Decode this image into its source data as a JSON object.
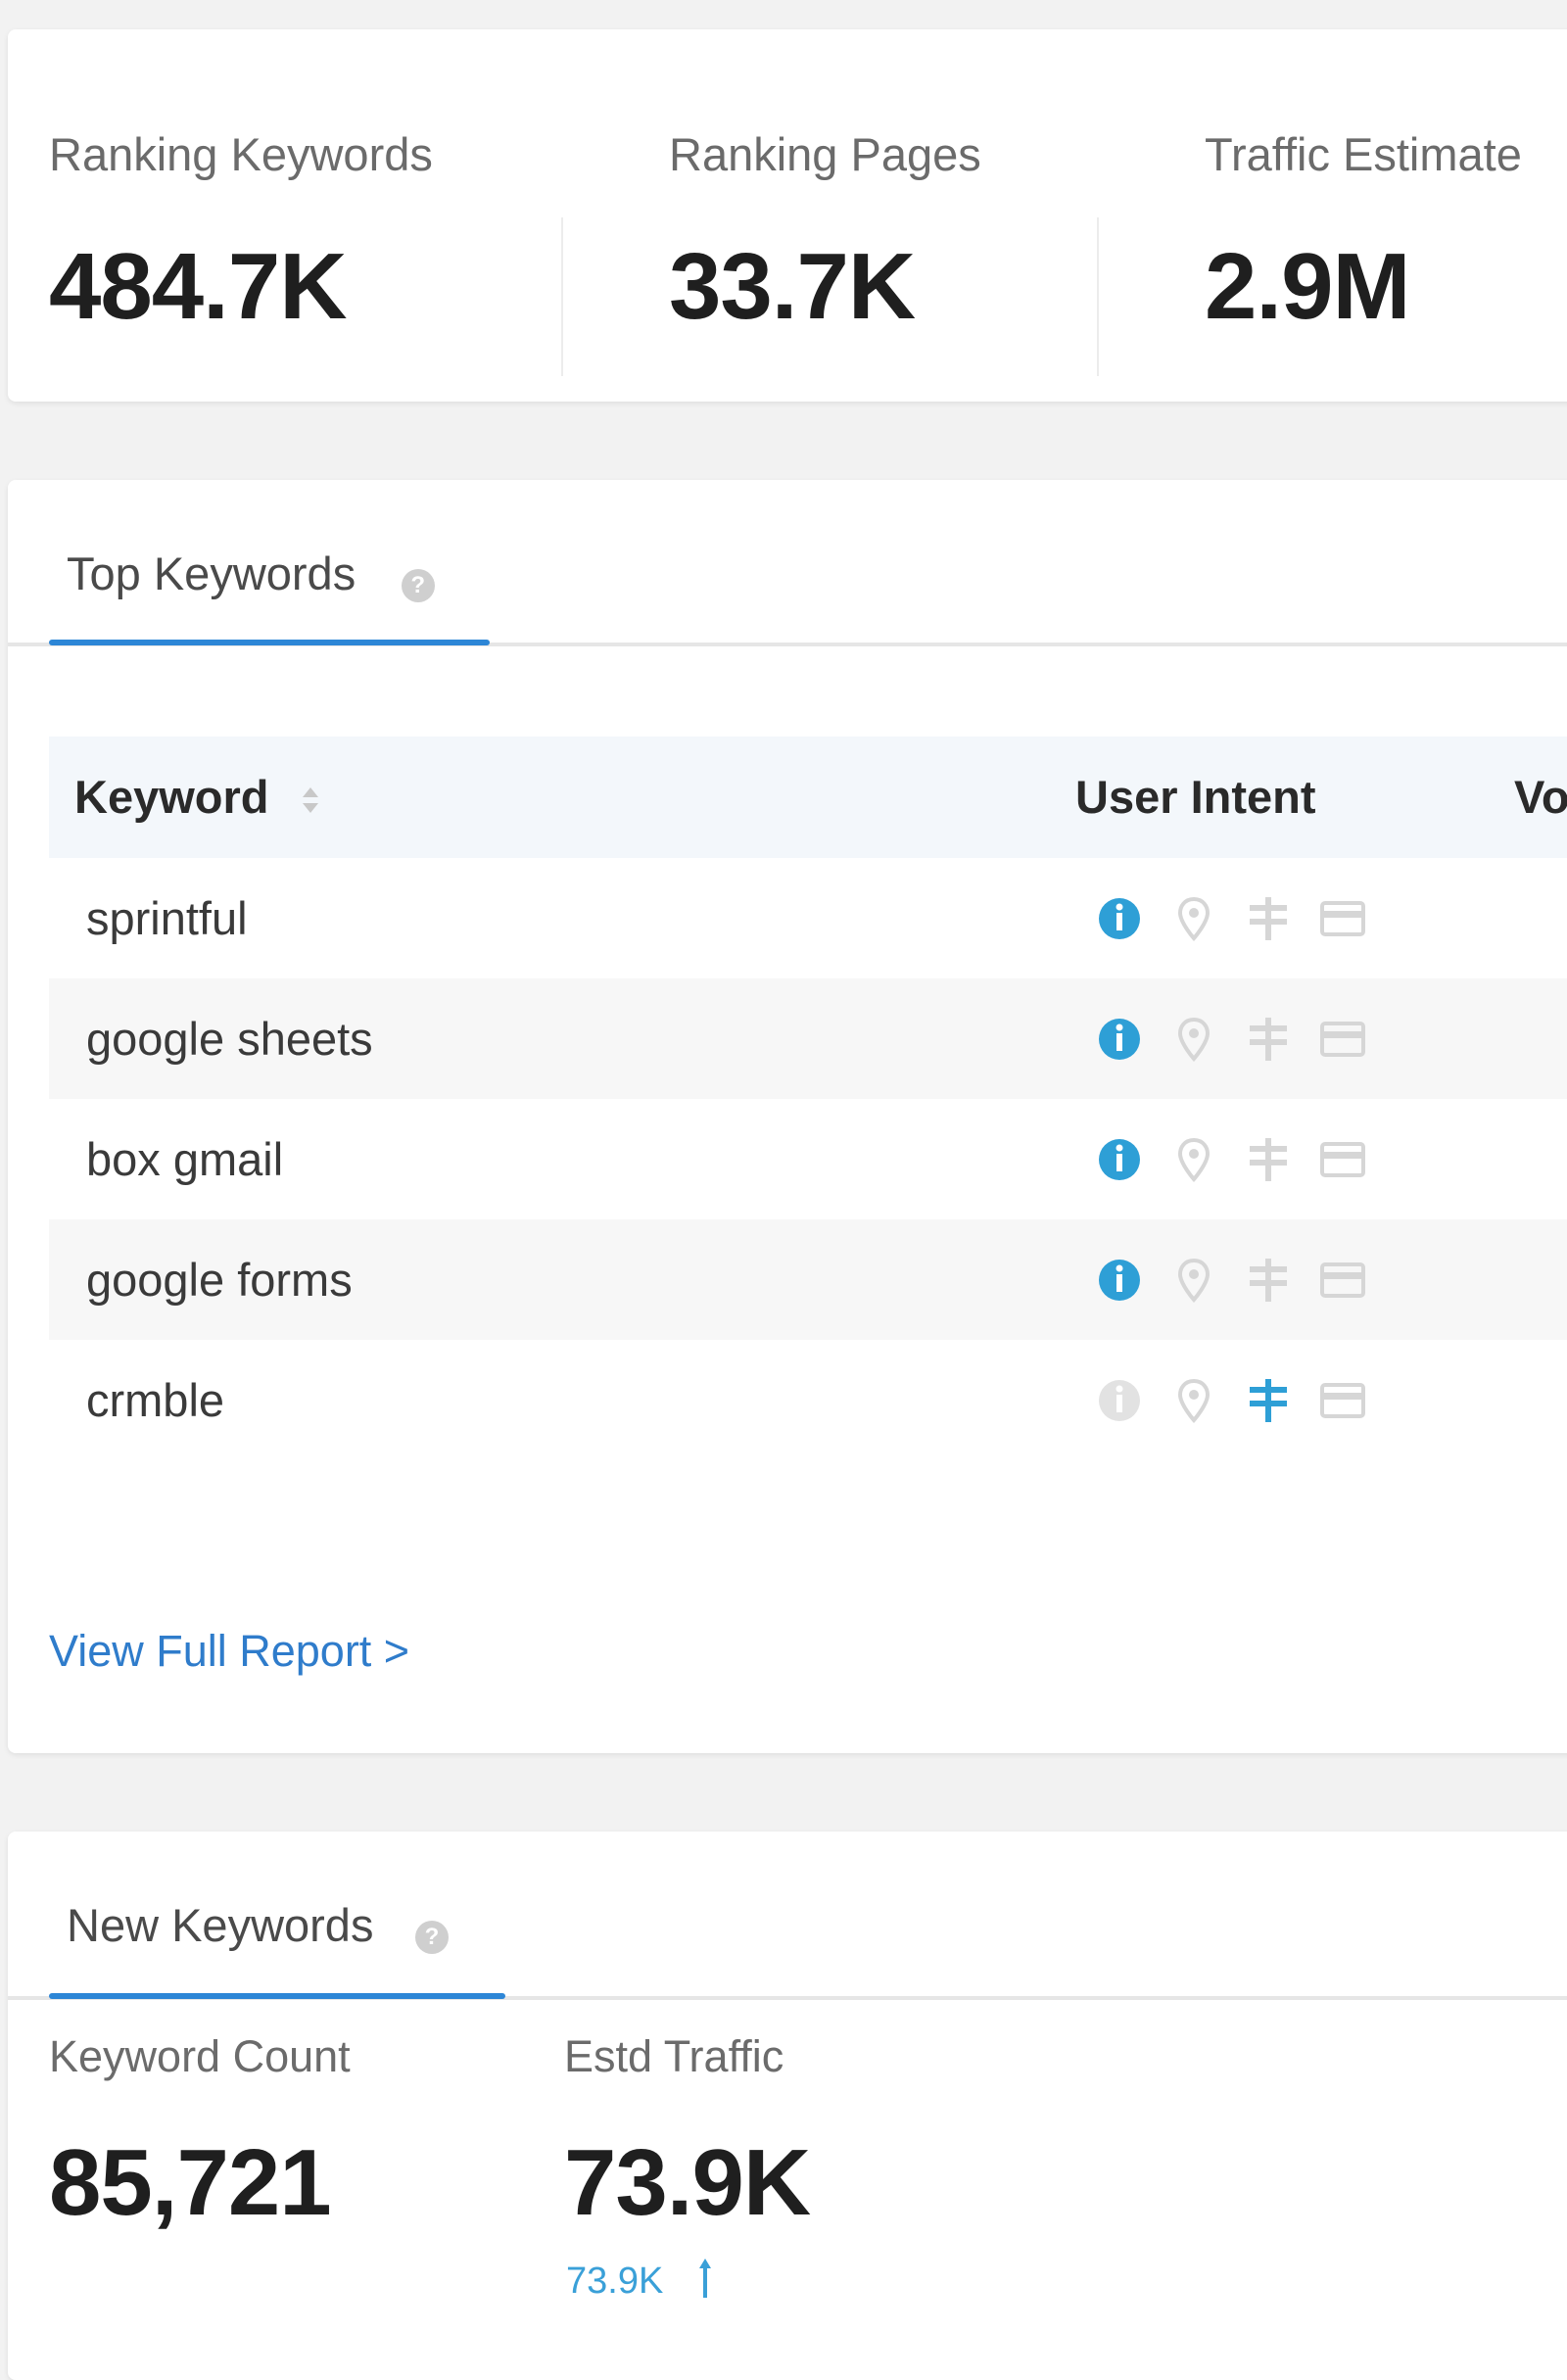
{
  "stats": [
    {
      "label": "Ranking Keywords",
      "value": "484.7K"
    },
    {
      "label": "Ranking Pages",
      "value": "33.7K"
    },
    {
      "label": "Traffic Estimate",
      "value": "2.9M"
    }
  ],
  "top_keywords": {
    "tab_label": "Top Keywords",
    "columns": {
      "keyword": "Keyword",
      "intent": "User Intent",
      "volume": "Vol"
    },
    "rows": [
      {
        "keyword": "sprintful",
        "active_intent": "informational"
      },
      {
        "keyword": "google sheets",
        "active_intent": "informational"
      },
      {
        "keyword": "box gmail",
        "active_intent": "informational"
      },
      {
        "keyword": "google forms",
        "active_intent": "informational"
      },
      {
        "keyword": "crmble",
        "active_intent": "navigational"
      }
    ],
    "intent_icons": [
      "info-icon",
      "location-pin-icon",
      "signpost-icon",
      "credit-card-icon"
    ],
    "view_full_report": "View Full Report >"
  },
  "new_keywords": {
    "tab_label": "New Keywords",
    "keyword_count_label": "Keyword Count",
    "keyword_count_value": "85,721",
    "estd_traffic_label": "Estd Traffic",
    "estd_traffic_value": "73.9K",
    "estd_traffic_delta": "73.9K"
  },
  "colors": {
    "accent": "#2d86d6",
    "intent_active": "#2e9fd6",
    "intent_inactive": "#d6d6d6",
    "link": "#2f7ccb"
  }
}
